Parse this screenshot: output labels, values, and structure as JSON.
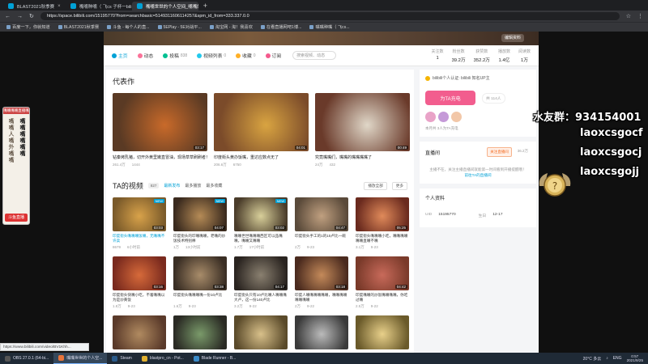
{
  "browser": {
    "tabs": [
      {
        "label": "BLAST2021秋季赛",
        "active": false
      },
      {
        "label": "嘴嘴种嘴（ 飞cs 子杯一bili",
        "active": false
      },
      {
        "label": "嘴嘴世世的个人空间_嘴嘴的嘴嘴",
        "active": true
      }
    ],
    "new_tab": "+",
    "url": "https://space.bilibili.com/15195770?from=searchbasic=5149311606114257&spm_id_from=333.337.0.0",
    "bookmarks": [
      "百度一下，你就知道",
      "BLAST2021秋季赛",
      "斗鱼 - 每个人的直...",
      "5EPlay - 5E对战平...",
      "淘宝网 - 淘！我喜欢",
      "在看直播网吧1博...",
      "嘴嘴种嘴（ 飞cs..."
    ]
  },
  "profile": {
    "banner_button": "编辑资料",
    "nav": [
      {
        "label": "主页",
        "count": "",
        "active": true
      },
      {
        "label": "动态",
        "count": "",
        "active": false
      },
      {
        "label": "投稿",
        "count": "838",
        "active": false
      },
      {
        "label": "视频列表",
        "count": "0",
        "active": false
      },
      {
        "label": "收藏",
        "count": "0",
        "active": false
      },
      {
        "label": "订阅",
        "count": "",
        "active": false
      }
    ],
    "search_placeholder": "搜索视频、动态",
    "stats": [
      {
        "label": "关注数",
        "value": "1"
      },
      {
        "label": "粉丝数",
        "value": "39.2万"
      },
      {
        "label": "获赞数",
        "value": "352.2万"
      },
      {
        "label": "播放数",
        "value": "1.4亿"
      },
      {
        "label": "阅读数",
        "value": "1万"
      }
    ]
  },
  "representative": {
    "heading": "代表作",
    "items": [
      {
        "title": "钻秦烤乳猪，切开外黄里嫩直冒油，现场草草刷刷者！",
        "plays": "261.4万",
        "danmaku": "1444",
        "duration": "03:17",
        "colors": [
          "#5a3a24",
          "#c96a2a"
        ]
      },
      {
        "title": "印度街头黄办饭嘴，重达应数点无了",
        "plays": "206.6万",
        "danmaku": "6750",
        "duration": "04:01",
        "colors": [
          "#7b4b2a",
          "#d9a441"
        ]
      },
      {
        "title": "究竟嘴嘴们，嘴嘴的嘴嘴嘴嘴了",
        "plays": "24万",
        "danmaku": "432",
        "duration": "00:49",
        "colors": [
          "#6a3a2a",
          "#e0d7c8"
        ]
      }
    ]
  },
  "videos": {
    "heading": "TA的视频",
    "count": "827",
    "sorts": [
      "最新发布",
      "最多播放",
      "最多收藏"
    ],
    "play_all": "播放全部",
    "more": "更多",
    "items": [
      {
        "title": "印度街头嘴嘴嘴饭嘴，无嘴嘴不许卖",
        "plays": "8679",
        "danmaku": "6小时前",
        "duration": "03:03",
        "badge": "NEW",
        "highlight": true,
        "colors": [
          "#7a5a2a",
          "#d8a24a"
        ]
      },
      {
        "title": "印度街头的印嘴嘴嘴，老嘴的炒饭技术特别棒",
        "plays": "1万",
        "danmaku": "13小时前",
        "duration": "04:07",
        "badge": "NEW",
        "highlight": false,
        "colors": [
          "#3a2a1e",
          "#b58b56"
        ]
      },
      {
        "title": "嘴嘴世世嘴嘴嘴西区可以品嘴嘴，嘴嘴又嘴嘴",
        "plays": "1.7万",
        "danmaku": "17小时前",
        "duration": "03:02",
        "badge": "NEW",
        "highlight": false,
        "colors": [
          "#4a3c2a",
          "#d8cf9a"
        ]
      },
      {
        "title": "印度街头手工的1的15卢比一碗",
        "plays": "2万",
        "danmaku": "9-23",
        "duration": "04:47",
        "badge": "",
        "highlight": false,
        "colors": [
          "#5a4a3a",
          "#c0a080"
        ]
      },
      {
        "title": "印度街头嘴嘴嘴小吃，嘴嘴嘴嘴嘴嘴直嘴不嘴",
        "plays": "3.1万",
        "danmaku": "9-23",
        "duration": "05:25",
        "badge": "",
        "highlight": false,
        "colors": [
          "#6a2a1e",
          "#e08a5a"
        ]
      },
      {
        "title": "印度街头快嘴小吃，不着嘴嘴以为是炒黄饭",
        "plays": "1.8万",
        "danmaku": "9-23",
        "duration": "03:16",
        "badge": "",
        "highlight": false,
        "colors": [
          "#7a2a1e",
          "#d66a3a"
        ]
      },
      {
        "title": "印度街头嘴嘴嘴嘴一份10卢比",
        "plays": "1.6万",
        "danmaku": "9-23",
        "duration": "03:38",
        "badge": "",
        "highlight": false,
        "colors": [
          "#3a2e24",
          "#a88c6a"
        ]
      },
      {
        "title": "印度街头只有10卢比嘴人嘴嘴嘴大卢，这一份140卢比",
        "plays": "3.2万",
        "danmaku": "9-22",
        "duration": "04:17",
        "badge": "",
        "highlight": false,
        "colors": [
          "#2a2420",
          "#8a8070"
        ]
      },
      {
        "title": "印度人嘴嘴嘴嘴嘴嘴，嘴嘴嘴嘴嘴嘴嘴嘴",
        "plays": "2万",
        "danmaku": "9-22",
        "duration": "03:18",
        "badge": "",
        "highlight": false,
        "colors": [
          "#4a2a1e",
          "#c48a5a"
        ]
      },
      {
        "title": "印度嘴嘴的炒饭嘴嘴嘴嘴，你吃过嘴",
        "plays": "2.5万",
        "danmaku": "9-22",
        "duration": "04:42",
        "badge": "",
        "highlight": false,
        "colors": [
          "#7a3a2a",
          "#c86a5a"
        ]
      },
      {
        "title": "",
        "plays": "",
        "danmaku": "",
        "duration": "",
        "badge": "",
        "highlight": false,
        "colors": [
          "#5a3a2a",
          "#b08a60"
        ]
      },
      {
        "title": "",
        "plays": "",
        "danmaku": "",
        "duration": "",
        "badge": "",
        "highlight": false,
        "colors": [
          "#2a2a24",
          "#7a9a6a"
        ]
      },
      {
        "title": "",
        "plays": "",
        "danmaku": "",
        "duration": "",
        "badge": "",
        "highlight": false,
        "colors": [
          "#5a4a2a",
          "#d8c08a"
        ]
      },
      {
        "title": "",
        "plays": "",
        "danmaku": "",
        "duration": "",
        "badge": "",
        "highlight": false,
        "colors": [
          "#3a3a3a",
          "#bbbbbb"
        ]
      },
      {
        "title": "",
        "plays": "",
        "danmaku": "",
        "duration": "",
        "badge": "",
        "highlight": false,
        "colors": [
          "#6a5a2a",
          "#e8d08a"
        ]
      }
    ]
  },
  "sidebar": {
    "cert": "bilibili个人认证: bilibili 知名UP主",
    "charge_button": "为TA充电",
    "charge_count": "共 114人",
    "fans_text": "本月共 3人为TA充电",
    "live_heading": "直播间",
    "live_follow": "关注直播间",
    "live_fans": "36.2万",
    "live_empty_line1": "主播不在，关注主播直播间就能第一时间看到开播提醒哦！",
    "live_link": "前往TA的直播间",
    "info_heading": "个人资料",
    "uid_label": "UID",
    "uid_value": "15195770",
    "birthday_label": "生日",
    "birthday_value": "12-17"
  },
  "overlay": {
    "line1": "水友群：934154001",
    "line2": "laoxcsgocf",
    "line3": "laoxcsgocj",
    "line4": "laoxcsgojj"
  },
  "sticker": {
    "top": "嘴嘴嘴嘴直播嘴",
    "col1": "嘴嘴人嘴外嘴嘴",
    "col2": "嘴嘴嘴嘴嘴嘴",
    "bottom": "斗鱼直播"
  },
  "statusbar": "https://www.bilibili.com/video/BV1Khh...",
  "taskbar": {
    "items": [
      "OBS 27.0.1 (64-bi...",
      "嘴嘴世世的个人空...",
      "Steam",
      "blastpro_cn - Pot...",
      "Blade Runner - B..."
    ],
    "weather": "20°C 多云",
    "lang": "ENG",
    "time": "0:57",
    "date": "2021/9/25"
  }
}
